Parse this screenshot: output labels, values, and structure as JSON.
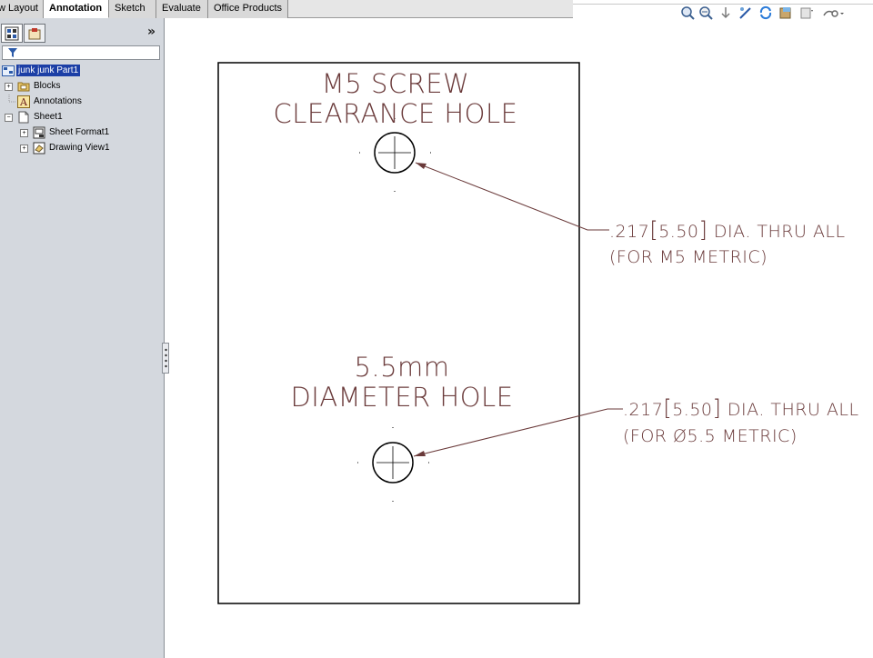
{
  "tabs": [
    {
      "label": "View Layout",
      "active": false
    },
    {
      "label": "Annotation",
      "active": true
    },
    {
      "label": "Sketch",
      "active": false
    },
    {
      "label": "Evaluate",
      "active": false
    },
    {
      "label": "Office Products",
      "active": false
    }
  ],
  "heads_up_toolbar": {
    "icons": [
      "zoom-to-fit-icon",
      "zoom-to-area-icon",
      "previous-view-icon",
      "sketch-icon",
      "rebuild-icon",
      "display-style-icon",
      "hide-show-icon",
      "view-settings-icon"
    ]
  },
  "feature_tree": {
    "collapse_glyph": "»",
    "nodes": [
      {
        "label": "junk junk Part1",
        "highlighted": true
      },
      {
        "label": "Blocks"
      },
      {
        "label": "Annotations"
      },
      {
        "label": "Sheet1"
      },
      {
        "label": "Sheet Format1"
      },
      {
        "label": "Drawing View1"
      }
    ]
  },
  "drawing": {
    "title1_line1": "M5 SCREW",
    "title1_line2": "CLEARANCE HOLE",
    "callout1_prefix": ".217",
    "callout1_metric": "5.50",
    "callout1_suffix": "DIA. THRU ALL",
    "callout1_line2": "(FOR M5 METRIC)",
    "title2_line1": "5.5mm",
    "title2_line2": "DIAMETER HOLE",
    "callout2_prefix": ".217",
    "callout2_metric": "5.50",
    "callout2_suffix": "DIA. THRU ALL",
    "callout2_line2": "(FOR Ø5.5 METRIC)",
    "annotation_color": "#6a3a3a"
  }
}
